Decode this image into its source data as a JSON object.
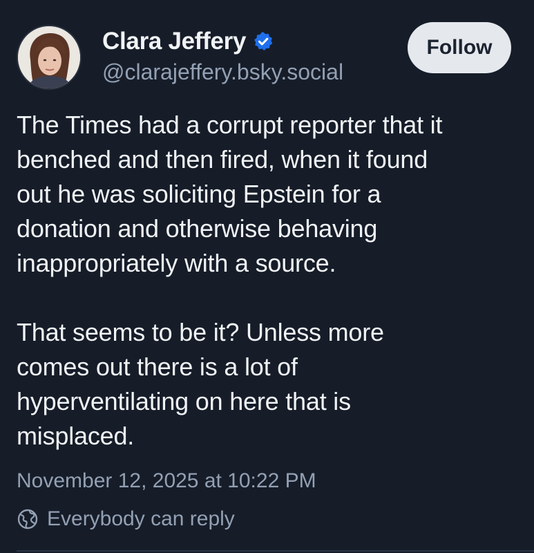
{
  "author": {
    "display_name": "Clara Jeffery",
    "verified_icon": "verified-check-icon",
    "handle": "@clarajeffery.bsky.social",
    "avatar": "avatar-photo"
  },
  "follow_button": {
    "label": "Follow"
  },
  "post": {
    "paragraphs": [
      "The Times had a corrupt reporter that it\nbenched and then fired, when it found\nout he was soliciting Epstein for a\ndonation and otherwise behaving\ninappropriately with a source.",
      "That seems to be it? Unless more\ncomes out there is a lot of\nhyperventilating on here that is\nmisplaced."
    ],
    "timestamp": "November 12, 2025 at 10:22 PM",
    "reply_setting": "Everybody can reply",
    "reply_icon": "globe-icon"
  },
  "colors": {
    "background": "#161d29",
    "text": "#f1f3f5",
    "muted": "#93a0b3",
    "verified": "#1f6feb",
    "button_bg": "#e5e8ed"
  }
}
